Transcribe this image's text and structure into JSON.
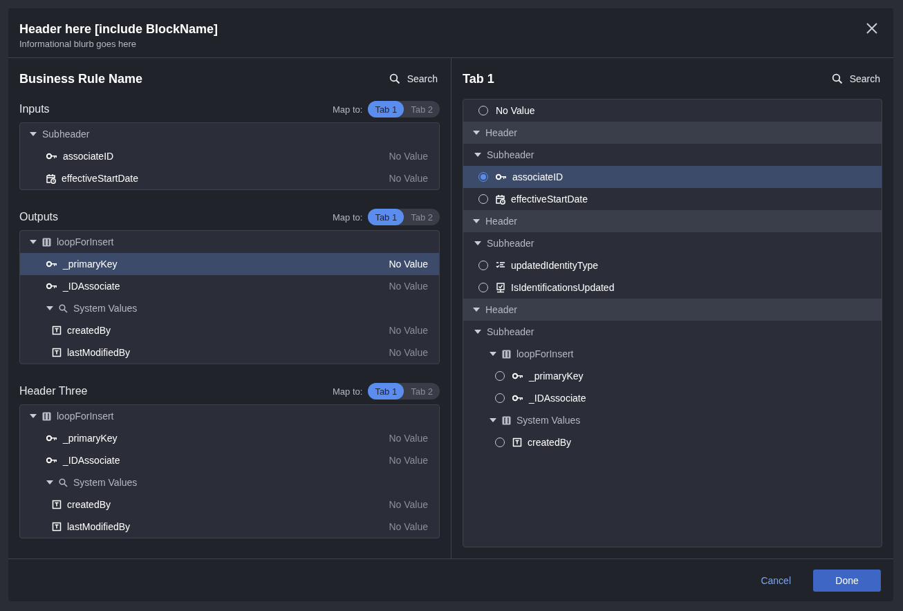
{
  "dialog": {
    "title": "Header here [include BlockName]",
    "subtitle": "Informational blurb goes here"
  },
  "left": {
    "title": "Business Rule Name",
    "search": "Search",
    "sections": [
      {
        "title": "Inputs",
        "map_label": "Map to:",
        "map_tabs": [
          {
            "label": "Tab 1",
            "selected": true
          },
          {
            "label": "Tab 2",
            "selected": false
          }
        ],
        "rows": [
          {
            "kind": "group",
            "label": "Subheader",
            "expanded": true,
            "children": [
              {
                "kind": "key",
                "label": "associateID",
                "value": "No Value",
                "selected": false
              },
              {
                "kind": "date",
                "label": "effectiveStartDate",
                "value": "No Value",
                "selected": false
              }
            ]
          }
        ]
      },
      {
        "title": "Outputs",
        "map_label": "Map to:",
        "map_tabs": [
          {
            "label": "Tab 1",
            "selected": true
          },
          {
            "label": "Tab 2",
            "selected": false
          }
        ],
        "rows": [
          {
            "kind": "loop",
            "label": "loopForInsert",
            "expanded": true,
            "children": [
              {
                "kind": "key",
                "label": "_primaryKey",
                "value": "No Value",
                "selected": true
              },
              {
                "kind": "key",
                "label": "_IDAssociate",
                "value": "No Value",
                "selected": false
              },
              {
                "kind": "search",
                "label": "System Values",
                "expanded": true,
                "children": [
                  {
                    "kind": "text",
                    "label": "createdBy",
                    "value": "No Value",
                    "selected": false
                  },
                  {
                    "kind": "text",
                    "label": "lastModifiedBy",
                    "value": "No Value",
                    "selected": false
                  }
                ]
              }
            ]
          }
        ]
      },
      {
        "title": "Header Three",
        "map_label": "Map to:",
        "map_tabs": [
          {
            "label": "Tab 1",
            "selected": true
          },
          {
            "label": "Tab 2",
            "selected": false
          }
        ],
        "rows": [
          {
            "kind": "loop",
            "label": "loopForInsert",
            "expanded": true,
            "children": [
              {
                "kind": "key",
                "label": "_primaryKey",
                "value": "No Value",
                "selected": false
              },
              {
                "kind": "key",
                "label": "_IDAssociate",
                "value": "No Value",
                "selected": false
              },
              {
                "kind": "search",
                "label": "System Values",
                "expanded": true,
                "children": [
                  {
                    "kind": "text",
                    "label": "createdBy",
                    "value": "No Value",
                    "selected": false
                  },
                  {
                    "kind": "text",
                    "label": "lastModifiedBy",
                    "value": "No Value",
                    "selected": false
                  }
                ]
              }
            ]
          }
        ]
      }
    ]
  },
  "right": {
    "title": "Tab 1",
    "search": "Search",
    "rows": [
      {
        "kind": "plain",
        "label": "No Value",
        "selected": false
      },
      {
        "kind": "header",
        "label": "Header",
        "expanded": true,
        "children": [
          {
            "kind": "group",
            "label": "Subheader",
            "expanded": true,
            "children": [
              {
                "kind": "key",
                "label": "associateID",
                "selected": true
              },
              {
                "kind": "date",
                "label": "effectiveStartDate",
                "selected": false
              }
            ]
          }
        ]
      },
      {
        "kind": "header",
        "label": "Header",
        "expanded": true,
        "children": [
          {
            "kind": "group",
            "label": "Subheader",
            "expanded": true,
            "children": [
              {
                "kind": "list",
                "label": "updatedIdentityType",
                "selected": false
              },
              {
                "kind": "boolean",
                "label": "IsIdentificationsUpdated",
                "selected": false
              }
            ]
          }
        ]
      },
      {
        "kind": "header",
        "label": "Header",
        "expanded": true,
        "children": [
          {
            "kind": "group",
            "label": "Subheader",
            "expanded": true,
            "children": [
              {
                "kind": "loop",
                "label": "loopForInsert",
                "expanded": true,
                "children": [
                  {
                    "kind": "key",
                    "label": "_primaryKey",
                    "selected": false
                  },
                  {
                    "kind": "key",
                    "label": "_IDAssociate",
                    "selected": false
                  }
                ]
              },
              {
                "kind": "loop",
                "label": "System Values",
                "expanded": true,
                "children": [
                  {
                    "kind": "text",
                    "label": "createdBy",
                    "selected": false
                  }
                ]
              }
            ]
          }
        ]
      }
    ]
  },
  "footer": {
    "cancel": "Cancel",
    "done": "Done"
  }
}
